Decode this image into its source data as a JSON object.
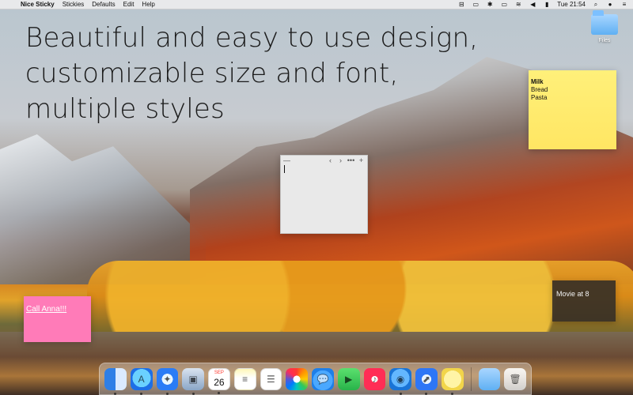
{
  "menubar": {
    "apple_icon": "apple-icon",
    "app_name": "Nice Sticky",
    "menus": [
      "Stickies",
      "Defaults",
      "Edit",
      "Help"
    ],
    "time": "Tue 21:54",
    "status_icons": [
      "finder-tag-icon",
      "clipboard-icon",
      "bluetooth-icon",
      "airplay-icon",
      "wifi-icon",
      "volume-icon",
      "battery-icon",
      "search-icon",
      "user-icon",
      "menu-icon"
    ]
  },
  "headline": {
    "lines": [
      "Beautiful and easy to use design,",
      "customizable size and font,",
      "multiple styles"
    ]
  },
  "desktop": {
    "folder_label": "Files"
  },
  "stickies": {
    "yellow": {
      "title": "Milk",
      "lines": [
        "Bread",
        "Pasta"
      ]
    },
    "pink": {
      "text": "Call Anna!!!"
    },
    "dark": {
      "text": "Movie at 8"
    },
    "gray": {
      "toolbar": [
        "—",
        "‹",
        "›",
        "•••",
        "+"
      ]
    }
  },
  "dock": {
    "calendar_month": "SEP",
    "calendar_day": "26",
    "items": [
      {
        "name": "finder-icon",
        "has_dot": true
      },
      {
        "name": "app-store-icon",
        "has_dot": true
      },
      {
        "name": "safari-icon",
        "has_dot": true
      },
      {
        "name": "preview-icon",
        "has_dot": true
      },
      {
        "name": "calendar-icon",
        "has_dot": true
      },
      {
        "name": "notes-icon",
        "has_dot": false
      },
      {
        "name": "reminders-icon",
        "has_dot": false
      },
      {
        "name": "photos-icon",
        "has_dot": false
      },
      {
        "name": "messages-icon",
        "has_dot": false
      },
      {
        "name": "facetime-icon",
        "has_dot": false
      },
      {
        "name": "music-icon",
        "has_dot": false
      },
      {
        "name": "tweetbot-icon",
        "has_dot": true
      },
      {
        "name": "compass-icon",
        "has_dot": true
      },
      {
        "name": "sticky-app-icon",
        "has_dot": true
      },
      {
        "name": "files-folder-icon",
        "has_dot": false
      },
      {
        "name": "trash-icon",
        "has_dot": false
      }
    ]
  }
}
